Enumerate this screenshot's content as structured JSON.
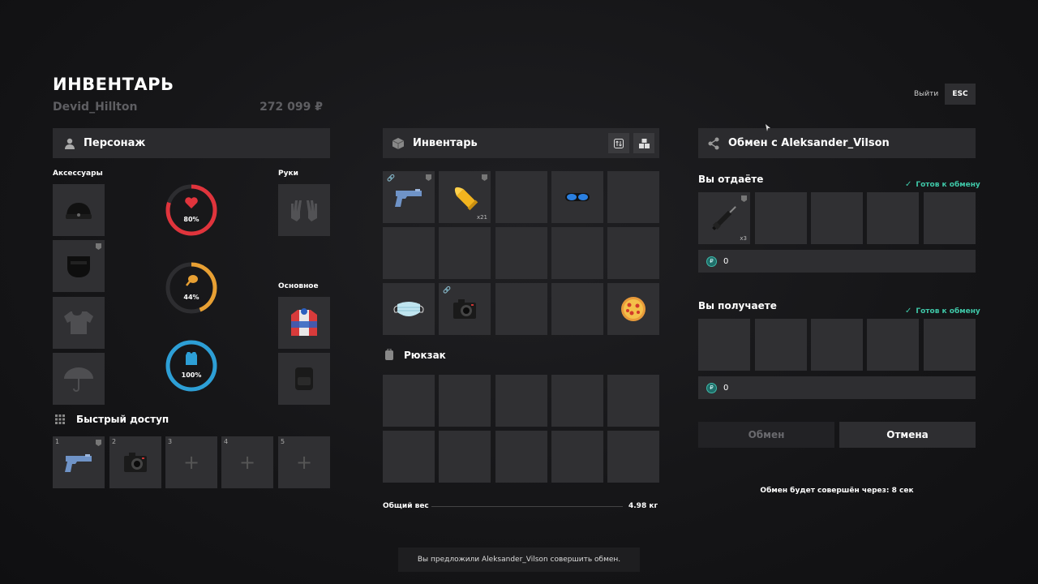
{
  "header": {
    "title": "ИНВЕНТАРЬ",
    "username": "Devid_Hillton",
    "balance": "272 099 ₽",
    "exit_label": "Выйти",
    "esc_label": "ESC"
  },
  "character": {
    "title": "Персонаж",
    "accessories_label": "Аксессуары",
    "hands_label": "Руки",
    "main_label": "Основное",
    "stats": [
      {
        "name": "health",
        "label": "80%",
        "value": 0.8,
        "color": "#e0343c"
      },
      {
        "name": "hunger",
        "label": "44%",
        "value": 0.44,
        "color": "#e8a033"
      },
      {
        "name": "armor",
        "label": "100%",
        "value": 1.0,
        "color": "#2d9fd6"
      }
    ]
  },
  "quick_access": {
    "title": "Быстрый доступ",
    "slots": [
      "1",
      "2",
      "3",
      "4",
      "5"
    ]
  },
  "inventory": {
    "title": "Инвентарь",
    "ammo_qty": "x21",
    "backpack_title": "Рюкзак",
    "weight_label": "Общий вес",
    "weight_value": "4.98 кг"
  },
  "trade": {
    "title": "Обмен с Aleksander_Vilson",
    "give_label": "Вы отдаёте",
    "receive_label": "Вы получаете",
    "ready_label": "Готов к обмену",
    "give_item_qty": "x3",
    "coin_symbol": "₽",
    "give_money": "0",
    "receive_money": "0",
    "exchange_button": "Обмен",
    "cancel_button": "Отмена",
    "timer_text": "Обмен будет совершён через: 8 сек"
  },
  "notification": "Вы предложили Aleksander_Vilson совершить обмен."
}
